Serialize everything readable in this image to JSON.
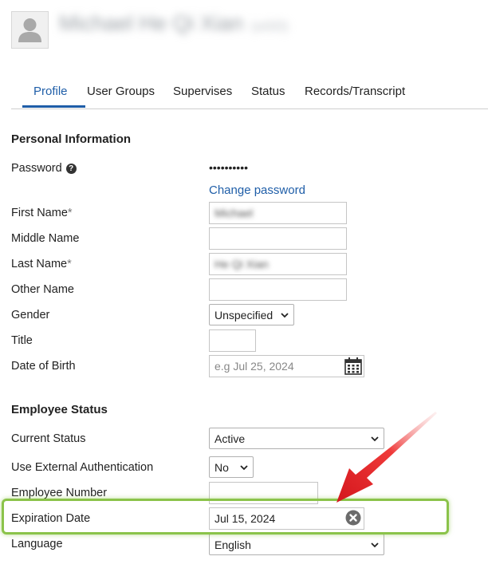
{
  "header": {
    "user_name": "Michael He Qi Xian",
    "user_sub": "(uGD)"
  },
  "tabs": [
    {
      "label": "Profile",
      "active": true
    },
    {
      "label": "User Groups",
      "active": false
    },
    {
      "label": "Supervises",
      "active": false
    },
    {
      "label": "Status",
      "active": false
    },
    {
      "label": "Records/Transcript",
      "active": false
    }
  ],
  "personal": {
    "section_title": "Personal Information",
    "password_label": "Password",
    "password_value": "••••••••••",
    "change_password": "Change password",
    "first_name_label": "First Name",
    "first_name_value": "Michael",
    "middle_name_label": "Middle Name",
    "middle_name_value": "",
    "last_name_label": "Last Name",
    "last_name_value": "He Qi Xian",
    "other_name_label": "Other Name",
    "other_name_value": "",
    "gender_label": "Gender",
    "gender_value": "Unspecified",
    "title_label": "Title",
    "title_value": "",
    "dob_label": "Date of Birth",
    "dob_placeholder": "e.g Jul 25, 2024",
    "required_mark": "*"
  },
  "employee": {
    "section_title": "Employee Status",
    "current_status_label": "Current Status",
    "current_status_value": "Active",
    "ext_auth_label": "Use External Authentication",
    "ext_auth_value": "No",
    "employee_number_label": "Employee Number",
    "employee_number_value": "",
    "expiration_label": "Expiration Date",
    "expiration_value": "Jul 15, 2024",
    "language_label": "Language",
    "language_value": "English"
  },
  "colors": {
    "accent": "#1f5ea8",
    "highlight": "#8bc34a",
    "arrow": "#e0242a"
  },
  "icons": [
    "user-avatar-icon",
    "help-icon",
    "calendar-icon",
    "clear-circle-icon",
    "chevron-down-icon",
    "red-arrow-annotation"
  ]
}
